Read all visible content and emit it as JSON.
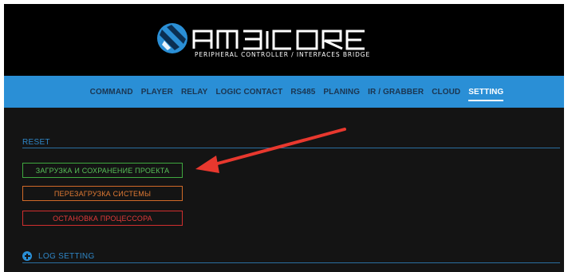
{
  "brand": {
    "name": "AMBICORE",
    "tagline": "PERIPHERAL CONTROLLER / INTERFACES BRIDGE"
  },
  "nav": {
    "items": [
      {
        "label": "COMMAND"
      },
      {
        "label": "PLAYER"
      },
      {
        "label": "RELAY"
      },
      {
        "label": "LOGIC CONTACT"
      },
      {
        "label": "RS485"
      },
      {
        "label": "PLANING"
      },
      {
        "label": "IR / GRABBER"
      },
      {
        "label": "CLOUD"
      },
      {
        "label": "SETTING"
      }
    ],
    "active": "SETTING"
  },
  "reset": {
    "title": "RESET",
    "buttons": {
      "load_save": "ЗАГРУЗКА И СОХРАНЕНИЕ ПРОЕКТА",
      "reboot": "ПЕРЕЗАГРУЗКА СИСТЕМЫ",
      "stop_cpu": "ОСТАНОВКА ПРОЦЕССОРА"
    }
  },
  "log_setting": {
    "title": "LOG SETTING"
  },
  "colors": {
    "accent": "#2a8fd6",
    "background": "#141414",
    "green": "#58c058",
    "orange": "#e07a34",
    "red": "#e03a3a",
    "annotation_arrow": "#e8382e"
  }
}
